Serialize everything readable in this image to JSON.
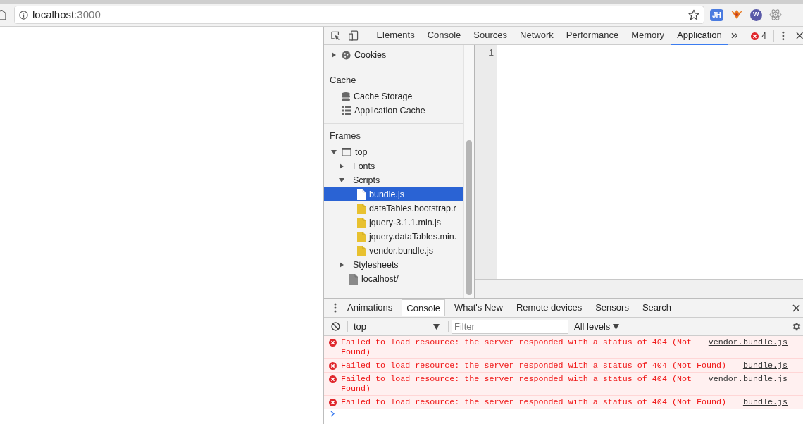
{
  "address_bar": {
    "host": "localhost",
    "port": ":3000"
  },
  "extensions": [
    {
      "kind": "badge",
      "label": "JH"
    },
    {
      "kind": "fox"
    },
    {
      "kind": "ws",
      "label": "W"
    },
    {
      "kind": "react"
    }
  ],
  "devtools_tabs": [
    {
      "label": "Elements",
      "selected": false
    },
    {
      "label": "Console",
      "selected": false
    },
    {
      "label": "Sources",
      "selected": false
    },
    {
      "label": "Network",
      "selected": false
    },
    {
      "label": "Performance",
      "selected": false
    },
    {
      "label": "Memory",
      "selected": false
    },
    {
      "label": "Application",
      "selected": true
    }
  ],
  "error_count": "4",
  "sidebar": {
    "sections": [
      {
        "items": [
          {
            "label": "Cookies",
            "kind": "cookies",
            "expanded": false,
            "selected": false
          }
        ]
      },
      {
        "title": "Cache",
        "items": [
          {
            "label": "Cache Storage",
            "kind": "cache-storage",
            "selected": false
          },
          {
            "label": "Application Cache",
            "kind": "app-cache",
            "selected": false
          }
        ]
      },
      {
        "title": "Frames",
        "items": [
          {
            "label": "top",
            "kind": "frame",
            "expanded": true,
            "selected": false,
            "children": [
              {
                "label": "Fonts",
                "kind": "folder",
                "expanded": false,
                "selected": false
              },
              {
                "label": "Scripts",
                "kind": "folder",
                "expanded": true,
                "selected": false,
                "children": [
                  {
                    "label": "bundle.js",
                    "kind": "script",
                    "selected": true
                  },
                  {
                    "label": "dataTables.bootstrap.r",
                    "kind": "script",
                    "selected": false
                  },
                  {
                    "label": "jquery-3.1.1.min.js",
                    "kind": "script",
                    "selected": false
                  },
                  {
                    "label": "jquery.dataTables.min.",
                    "kind": "script",
                    "selected": false
                  },
                  {
                    "label": "vendor.bundle.js",
                    "kind": "script",
                    "selected": false
                  }
                ]
              },
              {
                "label": "Stylesheets",
                "kind": "folder",
                "expanded": false,
                "selected": false
              },
              {
                "label": "localhost/",
                "kind": "document",
                "selected": false
              }
            ]
          }
        ]
      }
    ]
  },
  "editor": {
    "line_numbers": [
      "1"
    ]
  },
  "drawer_tabs": [
    {
      "label": "Animations",
      "selected": false
    },
    {
      "label": "Console",
      "selected": true
    },
    {
      "label": "What's New",
      "selected": false
    },
    {
      "label": "Remote devices",
      "selected": false
    },
    {
      "label": "Sensors",
      "selected": false
    },
    {
      "label": "Search",
      "selected": false
    }
  ],
  "console_toolbar": {
    "context": "top",
    "filter": {
      "placeholder": "Filter"
    },
    "levels": "All levels"
  },
  "messages": [
    {
      "text": "Failed to load resource: the server responded with a status of 404 (Not Found)",
      "source": "vendor.bundle.js"
    },
    {
      "text": "Failed to load resource: the server responded with a status of 404 (Not Found)",
      "source": "bundle.js"
    },
    {
      "text": "Failed to load resource: the server responded with a status of 404 (Not Found)",
      "source": "vendor.bundle.js"
    },
    {
      "text": "Failed to load resource: the server responded with a status of 404 (Not Found)",
      "source": "bundle.js"
    }
  ]
}
